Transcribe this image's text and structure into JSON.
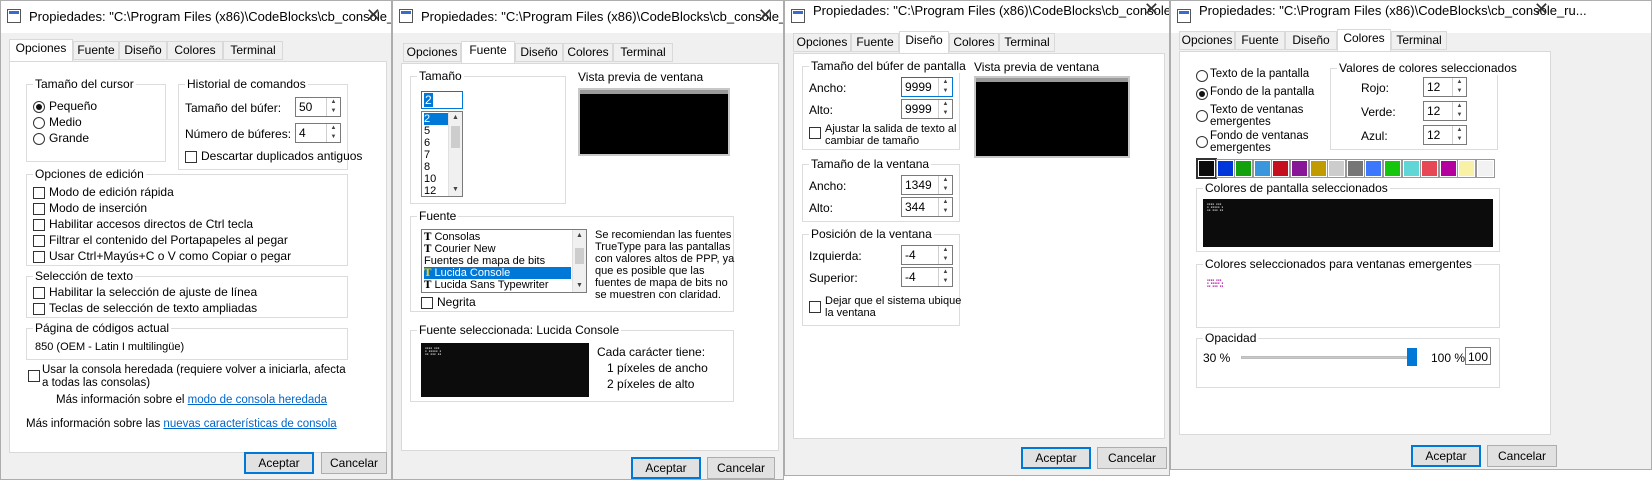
{
  "title": "Propiedades: \"C:\\Program Files (x86)\\CodeBlocks\\cb_console_ru...",
  "tabs": [
    "Opciones",
    "Fuente",
    "Diseño",
    "Colores",
    "Terminal"
  ],
  "buttons": {
    "ok": "Aceptar",
    "cancel": "Cancelar"
  },
  "w1": {
    "cursor": {
      "title": "Tamaño del cursor",
      "options": [
        "Pequeño",
        "Medio",
        "Grande"
      ],
      "selected": 0
    },
    "history": {
      "title": "Historial de comandos",
      "buffer_size_label": "Tamaño del búfer:",
      "buffer_size": "50",
      "buffer_count_label": "Número de búferes:",
      "buffer_count": "4",
      "discard": "Descartar duplicados antiguos"
    },
    "edit": {
      "title": "Opciones de edición",
      "items": [
        "Modo de edición rápida",
        "Modo de inserción",
        "Habilitar accesos directos de Ctrl tecla",
        "Filtrar el contenido del Portapapeles al pegar",
        "Usar Ctrl+Mayús+C o V como Copiar o pegar"
      ]
    },
    "selection": {
      "title": "Selección de texto",
      "items": [
        "Habilitar la selección de ajuste de línea",
        "Teclas de selección de texto ampliadas"
      ]
    },
    "codepage": {
      "title": "Página de códigos actual",
      "value": "850   (OEM - Latin I multilingüe)"
    },
    "legacy": {
      "line1": "Usar la consola heredada (requiere volver a iniciarla, afecta",
      "line2": "a todas las consolas)"
    },
    "info1_prefix": "Más información sobre el ",
    "info1_link": "modo de consola heredada",
    "info2_prefix": "Más información sobre las ",
    "info2_link": "nuevas características de consola"
  },
  "w2": {
    "size": {
      "title": "Tamaño",
      "value": "2",
      "items": [
        "2",
        "5",
        "6",
        "7",
        "8",
        "10",
        "12"
      ]
    },
    "preview_label": "Vista previa de ventana",
    "font": {
      "title": "Fuente",
      "items": [
        "Consolas",
        "Courier New",
        "Fuentes de mapa de bits",
        "Lucida Console",
        "Lucida Sans Typewriter"
      ],
      "note": [
        "Se recomiendan las fuentes",
        "TrueType para las pantallas",
        "con valores altos de PPP, ya",
        "que es posible que las",
        "fuentes de mapa de bits no",
        "se muestren con claridad."
      ],
      "bold": "Negrita"
    },
    "selected": {
      "title": "Fuente seleccionada: Lucida Console",
      "each": "Cada carácter tiene:",
      "width": "1 píxeles de ancho",
      "height": "2 píxeles de alto"
    }
  },
  "w3": {
    "buffer": {
      "title": "Tamaño del búfer de pantalla",
      "width_label": "Ancho:",
      "width": "9999",
      "height_label": "Alto:",
      "height": "9999",
      "wrap1": "Ajustar la salida de texto al",
      "wrap2": "cambiar de tamaño"
    },
    "window": {
      "title": "Tamaño de la ventana",
      "width_label": "Ancho:",
      "width": "1349",
      "height_label": "Alto:",
      "height": "344"
    },
    "position": {
      "title": "Posición de la ventana",
      "left_label": "Izquierda:",
      "left": "-4",
      "top_label": "Superior:",
      "top": "-4",
      "auto1": "Dejar que el sistema ubique",
      "auto2": "la ventana"
    },
    "preview_label": "Vista previa de ventana"
  },
  "w4": {
    "targets": [
      "Texto de la pantalla",
      "Fondo de la pantalla",
      "Texto de ventanas",
      "emergentes",
      "Fondo de ventanas",
      "emergentes"
    ],
    "selected_target": 1,
    "values": {
      "title": "Valores de colores seleccionados",
      "red_label": "Rojo:",
      "red": "12",
      "green_label": "Verde:",
      "green": "12",
      "blue_label": "Azul:",
      "blue": "12"
    },
    "palette": [
      "#0c0c0c",
      "#0037da",
      "#13a10e",
      "#3a96dd",
      "#c50f1f",
      "#881798",
      "#c19c00",
      "#cccccc",
      "#767676",
      "#3b78ff",
      "#16c60c",
      "#61d6d6",
      "#e74856",
      "#b4009e",
      "#f9f1a5",
      "#f2f2f2"
    ],
    "screen_colors": "Colores de pantalla seleccionados",
    "popup_colors": "Colores seleccionados para ventanas emergentes",
    "opacity": {
      "title": "Opacidad",
      "min": "30 %",
      "max": "100 %",
      "value": "100",
      "level": 1.0
    }
  }
}
